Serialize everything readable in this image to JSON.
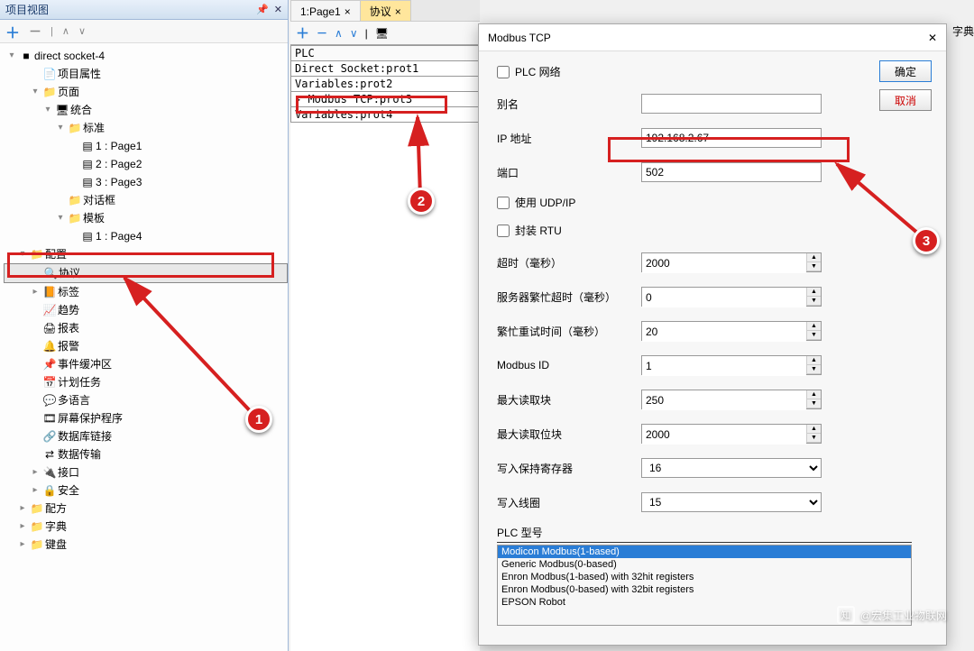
{
  "left": {
    "title": "项目视图",
    "toolbar": {
      "plus": "＋",
      "minus": "－"
    },
    "tree": [
      {
        "exp": "▾",
        "icon": "■",
        "label": "direct socket-4",
        "ind": 0
      },
      {
        "exp": "",
        "icon": "📄",
        "label": "项目属性",
        "ind": 2
      },
      {
        "exp": "▾",
        "icon": "📁",
        "label": "页面",
        "ind": 2
      },
      {
        "exp": "▾",
        "icon": "🖥",
        "label": "统合",
        "ind": 3
      },
      {
        "exp": "▾",
        "icon": "📁",
        "label": "标准",
        "ind": 4
      },
      {
        "exp": "",
        "icon": "▤",
        "label": "1 : Page1",
        "ind": 5
      },
      {
        "exp": "",
        "icon": "▤",
        "label": "2 : Page2",
        "ind": 5
      },
      {
        "exp": "",
        "icon": "▤",
        "label": "3 : Page3",
        "ind": 5
      },
      {
        "exp": "",
        "icon": "📁",
        "label": "对话框",
        "ind": 4
      },
      {
        "exp": "▾",
        "icon": "📁",
        "label": "模板",
        "ind": 4
      },
      {
        "exp": "",
        "icon": "▤",
        "label": "1 : Page4",
        "ind": 5
      },
      {
        "exp": "▾",
        "icon": "📁",
        "label": "配置",
        "ind": 1,
        "sel": false
      },
      {
        "exp": "",
        "icon": "🔍",
        "label": "协议",
        "ind": 2,
        "sel": true
      },
      {
        "exp": "▸",
        "icon": "📙",
        "label": "标签",
        "ind": 2
      },
      {
        "exp": "",
        "icon": "📈",
        "label": "趋势",
        "ind": 2
      },
      {
        "exp": "",
        "icon": "🖨",
        "label": "报表",
        "ind": 2
      },
      {
        "exp": "",
        "icon": "🔔",
        "label": "报警",
        "ind": 2
      },
      {
        "exp": "",
        "icon": "📌",
        "label": "事件缓冲区",
        "ind": 2
      },
      {
        "exp": "",
        "icon": "📅",
        "label": "计划任务",
        "ind": 2
      },
      {
        "exp": "",
        "icon": "💬",
        "label": "多语言",
        "ind": 2
      },
      {
        "exp": "",
        "icon": "🎞",
        "label": "屏幕保护程序",
        "ind": 2
      },
      {
        "exp": "",
        "icon": "🔗",
        "label": "数据库链接",
        "ind": 2
      },
      {
        "exp": "",
        "icon": "⇄",
        "label": "数据传输",
        "ind": 2
      },
      {
        "exp": "▸",
        "icon": "🔌",
        "label": "接口",
        "ind": 2
      },
      {
        "exp": "▸",
        "icon": "🔒",
        "label": "安全",
        "ind": 2
      },
      {
        "exp": "▸",
        "icon": "📁",
        "label": "配方",
        "ind": 1
      },
      {
        "exp": "▸",
        "icon": "📁",
        "label": "字典",
        "ind": 1
      },
      {
        "exp": "▸",
        "icon": "📁",
        "label": "键盘",
        "ind": 1
      }
    ]
  },
  "tabs": {
    "t1": "1:Page1",
    "t2": "协议",
    "x": "×"
  },
  "plc": {
    "head": "PLC",
    "rows": [
      "Direct Socket:prot1",
      "Variables:prot2",
      "Modbus TCP:prot3",
      "Variables:prot4"
    ]
  },
  "dialog": {
    "title": "Modbus TCP",
    "close": "✕",
    "ok": "确定",
    "cancel": "取消",
    "plc_net": "PLC 网络",
    "alias_lbl": "别名",
    "alias_val": "",
    "ip_lbl": "IP 地址",
    "ip_val": "192.168.2.67",
    "port_lbl": "端口",
    "port_val": "502",
    "udp": "使用 UDP/IP",
    "rtu": "封装 RTU",
    "timeout_lbl": "超时（毫秒）",
    "timeout_val": "2000",
    "busy_lbl": "服务器繁忙超时（毫秒）",
    "busy_val": "0",
    "retry_lbl": "繁忙重试时间（毫秒）",
    "retry_val": "20",
    "mid_lbl": "Modbus ID",
    "mid_val": "1",
    "maxr_lbl": "最大读取块",
    "maxr_val": "250",
    "maxrb_lbl": "最大读取位块",
    "maxrb_val": "2000",
    "hold_lbl": "写入保持寄存器",
    "hold_val": "16",
    "coil_lbl": "写入线圈",
    "coil_val": "15",
    "model_lbl": "PLC 型号",
    "models": [
      "Modicon Modbus(1-based)",
      "Generic Modbus(0-based)",
      "Enron Modbus(1-based) with 32hit registers",
      "Enron Modbus(0-based) with 32bit registers",
      "EPSON Robot"
    ]
  },
  "rightstrip": {
    "t1": "字典",
    "r": "avail"
  },
  "badges": {
    "b1": "1",
    "b2": "2",
    "b3": "3"
  },
  "wm": {
    "logo": "知",
    "text": "@宏集工业物联网"
  }
}
